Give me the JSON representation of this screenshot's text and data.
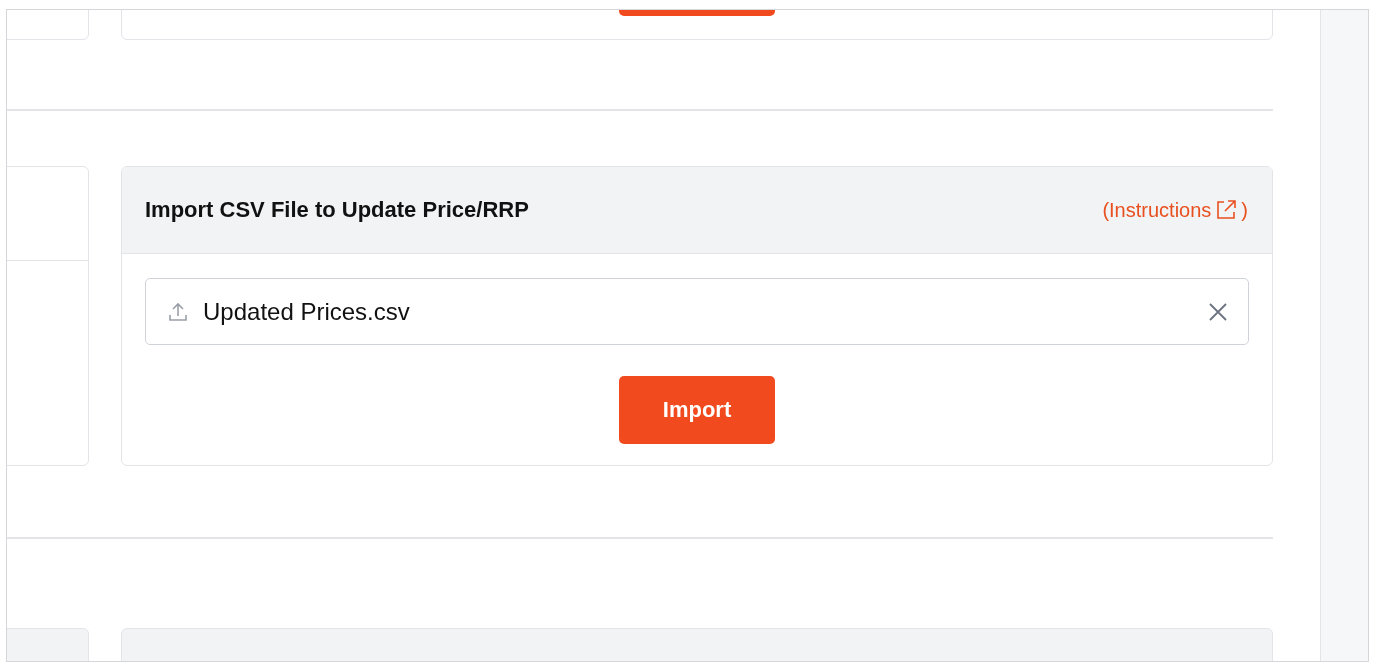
{
  "import_card": {
    "title": "Import CSV File to Update Price/RRP",
    "instructions_link": {
      "open": "(Instructions",
      "close": ")"
    },
    "file_field": {
      "value": "Updated Prices.csv"
    },
    "button": "Import"
  }
}
